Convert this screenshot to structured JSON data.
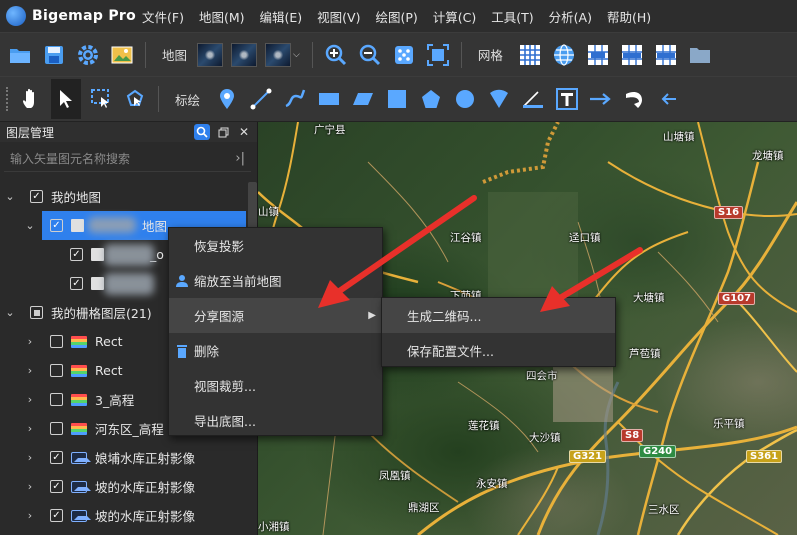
{
  "app": {
    "name": "Bigemap Pro"
  },
  "menu": [
    "文件(F)",
    "地图(M)",
    "编辑(E)",
    "视图(V)",
    "绘图(P)",
    "计算(C)",
    "工具(T)",
    "分析(A)",
    "帮助(H)"
  ],
  "toolbar1": {
    "map_label": "地图",
    "grid_label": "网格"
  },
  "toolbar2": {
    "annotate_label": "标绘"
  },
  "panel": {
    "title": "图层管理",
    "search_placeholder": "输入矢量图元名称搜索",
    "tree": {
      "my_map": "我的地图",
      "selected_map": "地图",
      "child1_suffix": "_o",
      "raster_group": "我的栅格图层(21)",
      "raster_layers": [
        "Rect",
        "Rect",
        "3_高程",
        "河东区_高程",
        "娘埔水库正射影像",
        "坡的水库正射影像",
        "坡的水库正射影像"
      ]
    }
  },
  "context_menu": {
    "items": [
      "恢复投影",
      "缩放至当前地图",
      "分享图源",
      "删除",
      "视图裁剪...",
      "导出底图..."
    ],
    "submenu": [
      "生成二维码...",
      "保存配置文件..."
    ]
  },
  "map": {
    "places": [
      {
        "text": "广宁县"
      },
      {
        "text": "山塘镇"
      },
      {
        "text": "龙塘镇"
      },
      {
        "text": "山镇"
      },
      {
        "text": "江谷镇"
      },
      {
        "text": "迳口镇"
      },
      {
        "text": "下茆镇"
      },
      {
        "text": "大塘镇"
      },
      {
        "text": "芦苞镇"
      },
      {
        "text": "四会市"
      },
      {
        "text": "莲花镇"
      },
      {
        "text": "大沙镇"
      },
      {
        "text": "乐平镇"
      },
      {
        "text": "凤凰镇"
      },
      {
        "text": "永安镇"
      },
      {
        "text": "鼎湖区"
      },
      {
        "text": "三水区"
      },
      {
        "text": "小湘镇"
      }
    ],
    "routes": [
      {
        "text": "S16",
        "color": "red"
      },
      {
        "text": "G107",
        "color": "red"
      },
      {
        "text": "S8",
        "color": "red"
      },
      {
        "text": "G321",
        "color": "yellow"
      },
      {
        "text": "G240",
        "color": "green"
      },
      {
        "text": "S361",
        "color": "yellow"
      }
    ]
  },
  "colors": {
    "accent": "#2f80ed",
    "arrow": "#e8302a"
  }
}
